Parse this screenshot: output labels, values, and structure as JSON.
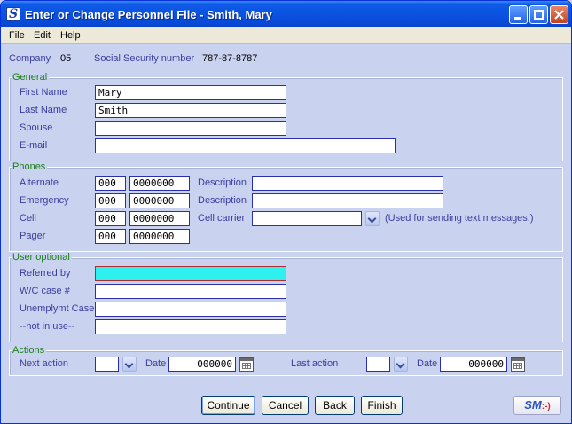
{
  "window": {
    "title": "Enter or Change Personnel File - Smith, Mary",
    "icon": "S"
  },
  "menu": [
    "File",
    "Edit",
    "Help"
  ],
  "header": {
    "company_label": "Company",
    "company_value": "05",
    "ssn_label": "Social Security number",
    "ssn_value": "787-87-8787"
  },
  "general": {
    "title": "General",
    "first_name_label": "First Name",
    "first_name": "Mary",
    "last_name_label": "Last Name",
    "last_name": "Smith",
    "spouse_label": "Spouse",
    "spouse": "",
    "email_label": "E-mail",
    "email": ""
  },
  "phones": {
    "title": "Phones",
    "alternate_label": "Alternate",
    "alternate_area": "000",
    "alternate_number": "0000000",
    "emergency_label": "Emergency",
    "emergency_area": "000",
    "emergency_number": "0000000",
    "cell_label": "Cell",
    "cell_area": "000",
    "cell_number": "0000000",
    "pager_label": "Pager",
    "pager_area": "000",
    "pager_number": "0000000",
    "description_label": "Description",
    "alternate_description": "",
    "emergency_description": "",
    "cell_carrier_label": "Cell carrier",
    "cell_carrier": "",
    "cell_carrier_note": "(Used for sending text messages.)"
  },
  "user_optional": {
    "title": "User optional",
    "referred_by_label": "Referred by",
    "referred_by": "",
    "wc_case_label": "W/C case #",
    "wc_case": "",
    "unemplymt_case_label": "Unemplymt Case",
    "unemplymt_case": "",
    "not_in_use_label": "--not in use--",
    "not_in_use": ""
  },
  "actions": {
    "title": "Actions",
    "next_action_label": "Next action",
    "next_action": "",
    "next_date_label": "Date",
    "next_date": "000000",
    "last_action_label": "Last action",
    "last_action": "",
    "last_date_label": "Date",
    "last_date": "000000"
  },
  "buttons": {
    "continue": "Continue",
    "cancel": "Cancel",
    "back": "Back",
    "finish": "Finish",
    "logo_text": "SM",
    "logo_face": ":-)"
  },
  "colors": {
    "background": "#c9d2ee",
    "label": "#3b3e9e",
    "group_title": "#1b7f1b",
    "field_border": "#2a2fb0",
    "highlight_field": "#2ef0ee"
  }
}
